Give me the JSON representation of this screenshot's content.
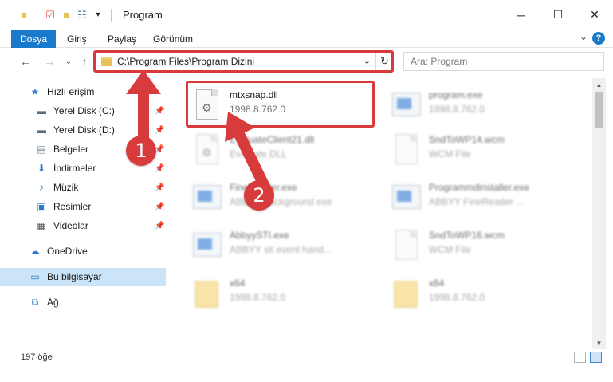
{
  "window": {
    "title": "Program",
    "controls": {
      "minimize": "─",
      "maximize": "☐",
      "close": "✕"
    }
  },
  "ribbon": {
    "tabs": [
      "Dosya",
      "Giriş",
      "Paylaş",
      "Görünüm"
    ],
    "expand": "⌄",
    "help": "?"
  },
  "nav": {
    "back": "←",
    "forward": "→",
    "recent": "⌄",
    "up": "↑",
    "address": "C:\\Program Files\\Program Dizini",
    "address_dropdown": "⌄",
    "refresh": "↻",
    "search_placeholder": "Ara: Program"
  },
  "sidebar": {
    "items": [
      {
        "label": "Hızlı erişim",
        "icon": "star-icon",
        "pinned": false
      },
      {
        "label": "Yerel Disk (C:)",
        "icon": "drive-icon",
        "pinned": true
      },
      {
        "label": "Yerel Disk (D:)",
        "icon": "drive-icon",
        "pinned": true
      },
      {
        "label": "Belgeler",
        "icon": "documents-icon",
        "pinned": true
      },
      {
        "label": "İndirmeler",
        "icon": "download-icon",
        "pinned": true
      },
      {
        "label": "Müzik",
        "icon": "music-icon",
        "pinned": true
      },
      {
        "label": "Resimler",
        "icon": "pictures-icon",
        "pinned": true
      },
      {
        "label": "Videolar",
        "icon": "videos-icon",
        "pinned": true
      },
      {
        "label": "OneDrive",
        "icon": "cloud-icon",
        "pinned": false
      },
      {
        "label": "Bu bilgisayar",
        "icon": "computer-icon",
        "pinned": false
      },
      {
        "label": "Ağ",
        "icon": "network-icon",
        "pinned": false
      }
    ]
  },
  "files": [
    {
      "name": "mtxsnap.dll",
      "sub": "1998.8.762.0",
      "icon": "dll-icon",
      "clear": true
    },
    {
      "name": "program.exe",
      "sub": "1998.8.762.0",
      "icon": "exe-icon",
      "clear": false
    },
    {
      "name": "EvaluateClient21.dll",
      "sub": "Evaluate DLL",
      "icon": "document-icon",
      "clear": false
    },
    {
      "name": "SndToWP14.wcm",
      "sub": "WCM File",
      "icon": "document-icon",
      "clear": false
    },
    {
      "name": "FineReader.exe",
      "sub": "ABBYY background exe",
      "icon": "exe-icon",
      "clear": false
    },
    {
      "name": "Programmdinstaller.exe",
      "sub": "ABBYY FineReader ...",
      "icon": "exe-icon",
      "clear": false
    },
    {
      "name": "AbbyySTI.exe",
      "sub": "ABBYY sti event hand...",
      "icon": "exe-icon",
      "clear": false
    },
    {
      "name": "SndToWP16.wcm",
      "sub": "WCM File",
      "icon": "document-icon",
      "clear": false
    },
    {
      "name": "x64",
      "sub": "1998.8.762.0",
      "icon": "folder-icon",
      "clear": false
    },
    {
      "name": "x64",
      "sub": "1998.8.762.0",
      "icon": "folder-icon",
      "clear": false
    }
  ],
  "status": {
    "count": "197 öğe"
  },
  "annotations": {
    "step1": "1",
    "step2": "2",
    "accent": "#d83b3b"
  }
}
